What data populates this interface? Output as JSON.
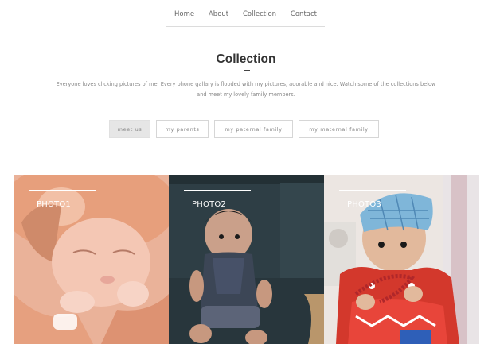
{
  "nav": {
    "items": [
      "Home",
      "About",
      "Collection",
      "Contact"
    ]
  },
  "section": {
    "title": "Collection",
    "intro": "Everyone loves clicking pictures of me. Every phone gallary is flooded with my pictures, adorable and nice. Watch some of the collections below and meet my lovely family members."
  },
  "filters": [
    "meet us",
    "my parents",
    "my paternal family",
    "my maternal family"
  ],
  "gallery": [
    {
      "caption": "PHOTO1"
    },
    {
      "caption": "PHOTO2"
    },
    {
      "caption": "PHOTO3"
    }
  ],
  "colors": {
    "active_filter_bg": "#e6e6e6",
    "photo1_tone": "#e9a98a",
    "photo2_tone": "#2f3f46",
    "photo3_tone": "#d93a2f"
  }
}
